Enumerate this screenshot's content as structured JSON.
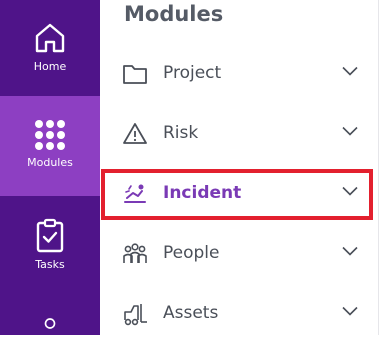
{
  "rail": {
    "items": [
      {
        "label": "Home",
        "icon": "home-icon",
        "active": false
      },
      {
        "label": "Modules",
        "icon": "grid-icon",
        "active": true
      },
      {
        "label": "Tasks",
        "icon": "clipboard-check-icon",
        "active": false
      },
      {
        "label": "",
        "icon": "user-icon",
        "active": false
      }
    ]
  },
  "panel": {
    "title": "Modules",
    "modules": [
      {
        "label": "Project",
        "icon": "folder-icon"
      },
      {
        "label": "Risk",
        "icon": "warning-icon"
      },
      {
        "label": "Incident",
        "icon": "incident-icon",
        "highlighted": true
      },
      {
        "label": "People",
        "icon": "people-icon"
      },
      {
        "label": "Assets",
        "icon": "forklift-icon"
      }
    ]
  },
  "colors": {
    "rail_bg": "#4f1489",
    "rail_active": "#8d3fc2",
    "accent": "#7a3ab5",
    "highlight_border": "#e3202e",
    "text": "#4a4f58"
  }
}
